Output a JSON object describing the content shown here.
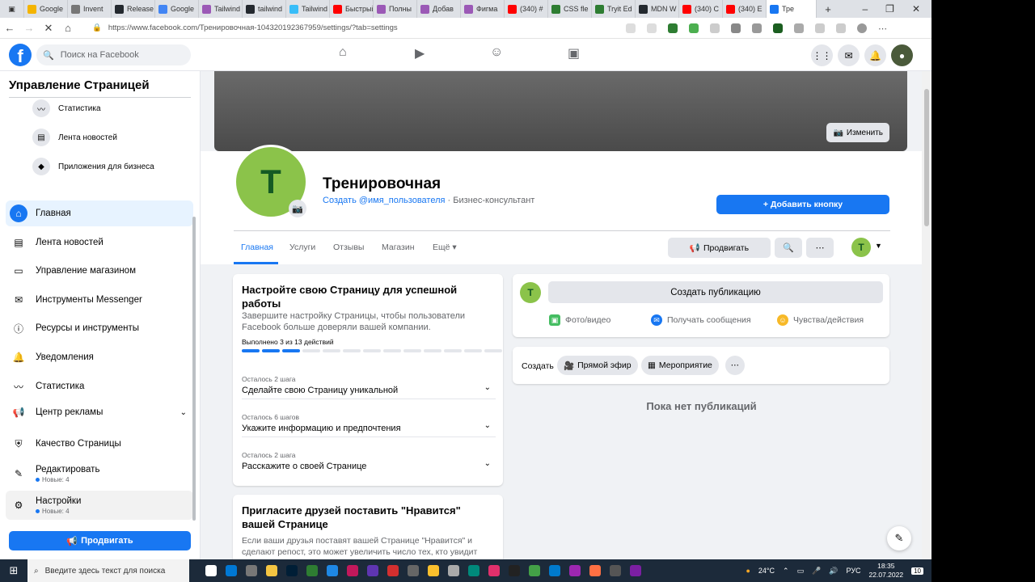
{
  "browser": {
    "tabs": [
      {
        "label": "Google",
        "color": "#f4b400"
      },
      {
        "label": "Invent",
        "color": "#777777"
      },
      {
        "label": "Release",
        "color": "#24292f"
      },
      {
        "label": "Google",
        "color": "#4285f4"
      },
      {
        "label": "Tailwind",
        "color": "#9b59b6"
      },
      {
        "label": "tailwind",
        "color": "#24292f"
      },
      {
        "label": "Tailwind",
        "color": "#38bdf8"
      },
      {
        "label": "Быстрый",
        "color": "#ff0000"
      },
      {
        "label": "Полны",
        "color": "#9b59b6"
      },
      {
        "label": "Добав",
        "color": "#9b59b6"
      },
      {
        "label": "Фигма",
        "color": "#9b59b6"
      },
      {
        "label": "(340) #",
        "color": "#ff0000"
      },
      {
        "label": "CSS fle",
        "color": "#2e7d32"
      },
      {
        "label": "Tryit Ed",
        "color": "#2e7d32"
      },
      {
        "label": "MDN W",
        "color": "#24292f"
      },
      {
        "label": "(340) C",
        "color": "#ff0000"
      },
      {
        "label": "(340) E",
        "color": "#ff0000"
      },
      {
        "label": "Тре",
        "color": "#1877f2"
      }
    ],
    "url": "https://www.facebook.com/Тренировочная-104320192367959/settings/?tab=settings"
  },
  "fb": {
    "search_placeholder": "Поиск на Facebook"
  },
  "sidebar": {
    "title": "Управление Страницей",
    "sub_items": [
      {
        "label": "Статистика",
        "icon": "chart-icon"
      },
      {
        "label": "Лента новостей",
        "icon": "feed-icon"
      },
      {
        "label": "Приложения для бизнеса",
        "icon": "cube-icon"
      }
    ],
    "items": [
      {
        "label": "Главная",
        "icon": "home-icon"
      },
      {
        "label": "Лента новостей",
        "icon": "feed-icon"
      },
      {
        "label": "Управление магазином",
        "icon": "shop-icon"
      },
      {
        "label": "Инструменты Messenger",
        "icon": "messenger-icon"
      },
      {
        "label": "Ресурсы и инструменты",
        "icon": "info-icon"
      },
      {
        "label": "Уведомления",
        "icon": "bell-icon"
      },
      {
        "label": "Статистика",
        "icon": "chart-icon"
      },
      {
        "label": "Центр рекламы",
        "icon": "megaphone-icon"
      },
      {
        "label": "Качество Страницы",
        "icon": "shield-icon"
      },
      {
        "label": "Редактировать",
        "icon": "pencil-icon",
        "note": "Новые: 4"
      },
      {
        "label": "Настройки",
        "icon": "gear-icon",
        "note": "Новые: 4"
      }
    ],
    "promote_label": "Продвигать"
  },
  "page": {
    "cover_edit_label": "Изменить",
    "avatar_letter": "T",
    "name": "Тренировочная",
    "username_link": "Создать @имя_пользователя",
    "category": " · Бизнес-консультант",
    "add_button_label": "+ Добавить кнопку",
    "tabs": [
      "Главная",
      "Услуги",
      "Отзывы",
      "Магазин",
      "Ещё ▾"
    ],
    "promote_label": "Продвигать"
  },
  "setup": {
    "title": "Настройте свою Страницу для успешной работы",
    "desc": "Завершите настройку Страницы, чтобы пользователи Facebook больше доверяли вашей компании.",
    "progress_text": "Выполнено 3 из 13 действий",
    "done": 3,
    "total": 13,
    "steps": [
      {
        "remaining": "Осталось 2 шага",
        "label": "Сделайте свою Страницу уникальной"
      },
      {
        "remaining": "Осталось 6 шагов",
        "label": "Укажите информацию и предпочтения"
      },
      {
        "remaining": "Осталось 2 шага",
        "label": "Расскажите о своей Странице"
      }
    ]
  },
  "invite": {
    "title": "Пригласите друзей поставить \"Нравится\" вашей Странице",
    "desc": "Если ваши друзья поставят вашей Странице \"Нравится\" и сделают репост, это может увеличить число тех, кто увидит ваши"
  },
  "composer": {
    "create_post": "Создать публикацию",
    "actions": [
      "Фото/видео",
      "Получать сообщения",
      "Чувства/действия"
    ]
  },
  "create_bar": {
    "label": "Создать",
    "chips": [
      "Прямой эфир",
      "Мероприятие"
    ]
  },
  "no_posts": "Пока нет публикаций",
  "taskbar": {
    "search_placeholder": "Введите здесь текст для поиска",
    "weather": "24°C",
    "lang": "РУС",
    "time": "18:35",
    "date": "22.07.2022",
    "notif_count": "10"
  }
}
